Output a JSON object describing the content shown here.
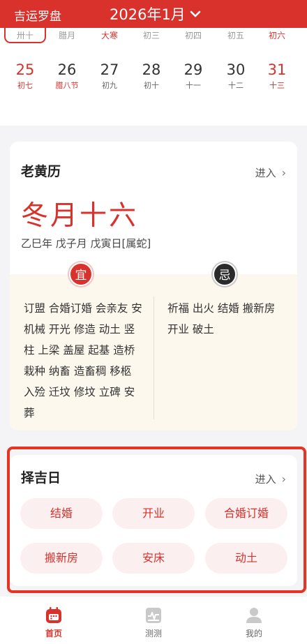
{
  "header": {
    "app_title": "吉运罗盘",
    "month_label": "2026年1月"
  },
  "calendar": {
    "partial_row": [
      {
        "text": "卅十",
        "selected": true,
        "red": false
      },
      {
        "text": "腊月",
        "selected": false,
        "red": false
      },
      {
        "text": "大寒",
        "selected": false,
        "red": true
      },
      {
        "text": "初三",
        "selected": false,
        "red": false
      },
      {
        "text": "初四",
        "selected": false,
        "red": false
      },
      {
        "text": "初五",
        "selected": false,
        "red": false
      },
      {
        "text": "初六",
        "selected": false,
        "red": true
      }
    ],
    "week": [
      {
        "day": "25",
        "lunar": "初七",
        "red": true
      },
      {
        "day": "26",
        "lunar": "腊八节",
        "red": false,
        "lunar_red": true
      },
      {
        "day": "27",
        "lunar": "初九",
        "red": false
      },
      {
        "day": "28",
        "lunar": "初十",
        "red": false
      },
      {
        "day": "29",
        "lunar": "十一",
        "red": false
      },
      {
        "day": "30",
        "lunar": "十二",
        "red": false
      },
      {
        "day": "31",
        "lunar": "十三",
        "red": true
      }
    ]
  },
  "almanac": {
    "title": "老黄历",
    "enter": "进入",
    "lunar_date": "冬月十六",
    "ganzhi": "乙巳年 戊子月 戊寅日[属蛇]",
    "yi_badge": "宜",
    "ji_badge": "忌",
    "yi_text": "订盟 合婚订婚 会亲友 安机械 开光 修造 动土 竖柱 上梁 盖屋 起基 造桥 栽种 纳畜 造畜稠 移柩 入殓 迁坟 修坟 立碑 安葬",
    "ji_text": "祈福 出火 结婚 搬新房 开业 破土"
  },
  "auspicious": {
    "title": "择吉日",
    "enter": "进入",
    "chips": [
      "结婚",
      "开业",
      "合婚订婚",
      "搬新房",
      "安床",
      "动土"
    ]
  },
  "tabbar": {
    "tabs": [
      {
        "label": "首页",
        "icon": "calendar-home-icon",
        "active": true
      },
      {
        "label": "测测",
        "icon": "chart-test-icon",
        "active": false
      },
      {
        "label": "我的",
        "icon": "user-profile-icon",
        "active": false
      }
    ]
  },
  "colors": {
    "brand_red": "#d9322c",
    "highlight_border": "#e63422",
    "yiji_background": "#fdf8ee",
    "chip_background": "#fcefef"
  }
}
